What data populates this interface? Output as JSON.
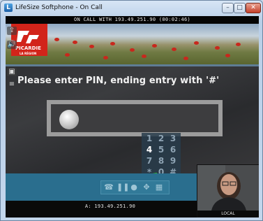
{
  "window": {
    "title": "LifeSize Softphone - On Call",
    "app_icon": "L",
    "controls": {
      "minimize": "–",
      "maximize": "□",
      "close": "✕"
    }
  },
  "call": {
    "status": "ON CALL WITH 193.49.251.90 (00:02:46)",
    "address": "A: 193.49.251.90"
  },
  "banner": {
    "logo_text": "PICARDIE",
    "logo_sub": "LA RÉGION"
  },
  "main": {
    "prompt": "Please enter PIN, ending entry with '#'"
  },
  "keypad": {
    "rows": [
      [
        "1",
        "2",
        "3"
      ],
      [
        "4",
        "5",
        "6"
      ],
      [
        "7",
        "8",
        "9"
      ],
      [
        "*",
        "0",
        "#"
      ]
    ]
  },
  "self_view": {
    "label": "LOCAL"
  },
  "colors": {
    "accent": "#2a6e8e",
    "pin_border": "#9c9c9c",
    "arrow": "#2fd12f"
  }
}
